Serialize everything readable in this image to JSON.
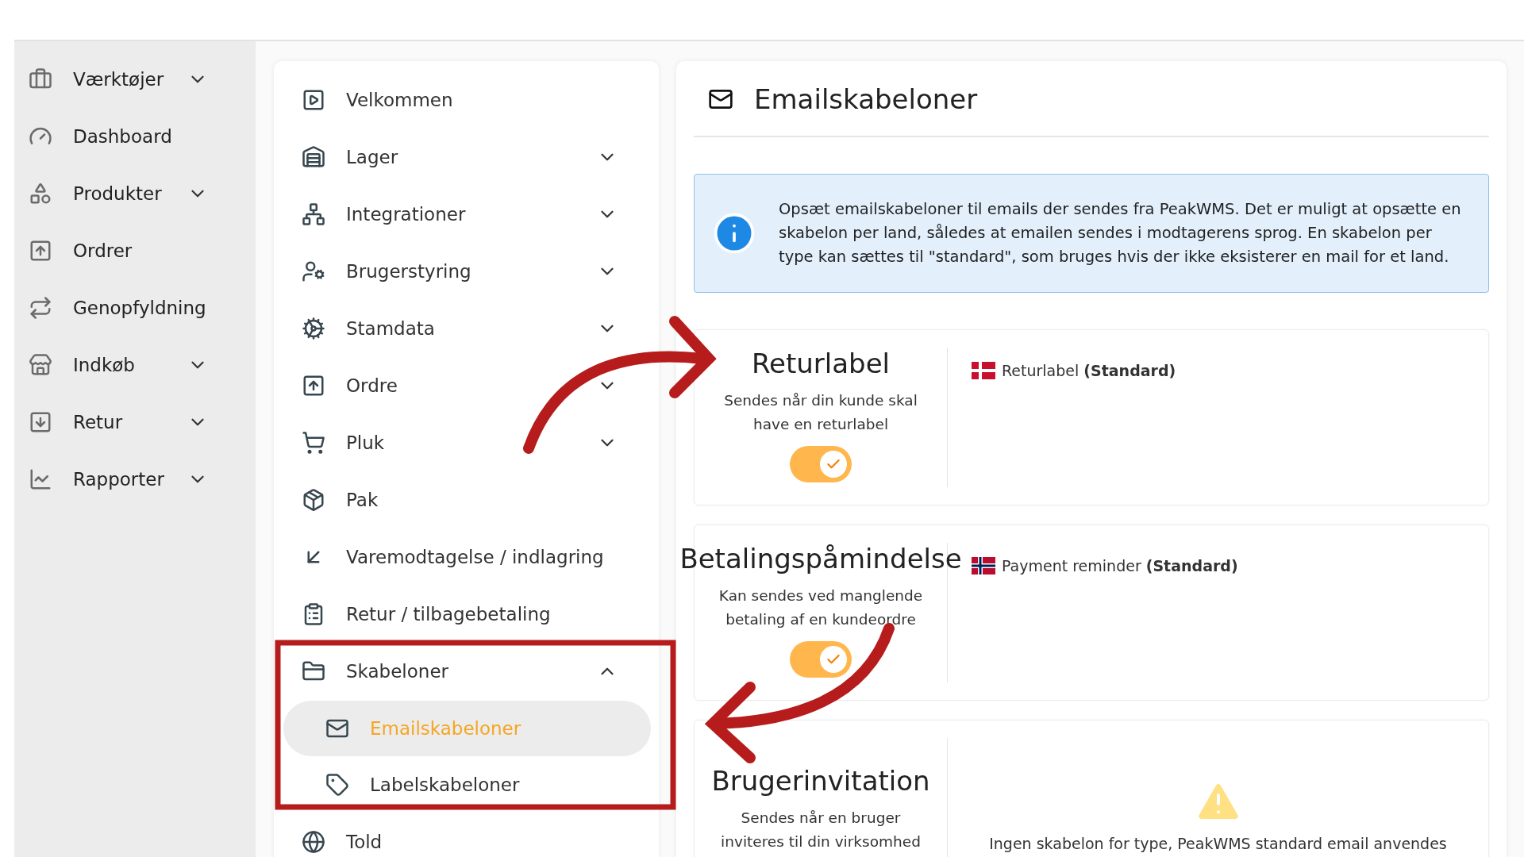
{
  "sidebar": {
    "items": [
      {
        "label": "Værktøjer",
        "kind": "group",
        "expanded": false
      },
      {
        "label": "Dashboard",
        "kind": "link"
      },
      {
        "label": "Produkter",
        "kind": "group",
        "expanded": false
      },
      {
        "label": "Ordrer",
        "kind": "link"
      },
      {
        "label": "Genopfyldning",
        "kind": "link"
      },
      {
        "label": "Indkøb",
        "kind": "group",
        "expanded": false
      },
      {
        "label": "Retur",
        "kind": "group",
        "expanded": false
      },
      {
        "label": "Rapporter",
        "kind": "group",
        "expanded": false
      }
    ]
  },
  "menu": {
    "items": [
      {
        "label": "Velkommen",
        "kind": "link"
      },
      {
        "label": "Lager",
        "kind": "group",
        "expanded": false
      },
      {
        "label": "Integrationer",
        "kind": "group",
        "expanded": false
      },
      {
        "label": "Brugerstyring",
        "kind": "group",
        "expanded": false
      },
      {
        "label": "Stamdata",
        "kind": "group",
        "expanded": false
      },
      {
        "label": "Ordre",
        "kind": "group",
        "expanded": false
      },
      {
        "label": "Pluk",
        "kind": "group",
        "expanded": false
      },
      {
        "label": "Pak",
        "kind": "link"
      },
      {
        "label": "Varemodtagelse / indlagring",
        "kind": "link"
      },
      {
        "label": "Retur / tilbagebetaling",
        "kind": "link"
      },
      {
        "label": "Skabeloner",
        "kind": "group",
        "expanded": true,
        "children": [
          {
            "label": "Emailskabeloner",
            "selected": true
          },
          {
            "label": "Labelskabeloner",
            "selected": false
          }
        ]
      },
      {
        "label": "Told",
        "kind": "link"
      }
    ]
  },
  "content": {
    "title": "Emailskabeloner",
    "info": "Opsæt emailskabeloner til emails der sendes fra PeakWMS. Det er muligt at opsætte en skabelon per land, således at emailen sendes i modtagerens sprog. En skabelon per type kan sættes til \"standard\", som bruges hvis der ikke eksisterer en mail for et land.",
    "cards": [
      {
        "title": "Returlabel",
        "description": "Sendes når din kunde skal have en returlabel",
        "toggle": {
          "on": true
        },
        "templates": [
          {
            "kind": "dk",
            "label": "Returlabel **(Standard)**"
          }
        ]
      },
      {
        "title": "Betalingspåmindelse",
        "description": "Kan sendes ved manglende betaling af en kundeordre",
        "toggle": {
          "on": true
        },
        "templates": [
          {
            "kind": "no",
            "label": "Payment reminder **(Standard)**"
          }
        ]
      },
      {
        "title": "Brugerinvitation",
        "description": "Sendes når en bruger inviteres til din virksomhed",
        "empty_message": "Ingen skabelon for type, PeakWMS standard email anvendes"
      }
    ]
  }
}
